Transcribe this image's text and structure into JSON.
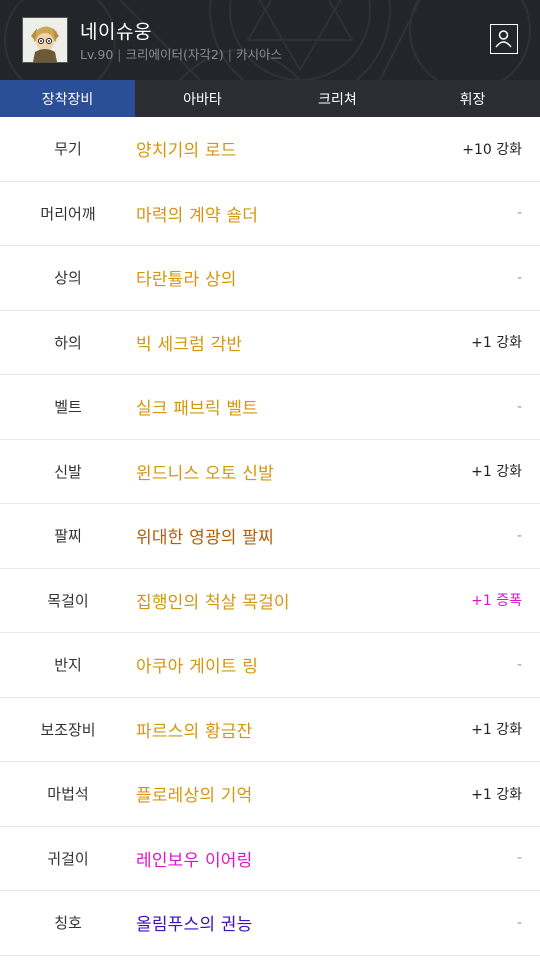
{
  "header": {
    "name": "네이슈웅",
    "level": "Lv.90",
    "job": "크리에이터(자각2)",
    "world": "카시아스",
    "avatar_icon": "character-avatar",
    "profile_icon": "profile-card-icon"
  },
  "tabs": [
    {
      "label": "장착장비",
      "active": true
    },
    {
      "label": "아바타",
      "active": false
    },
    {
      "label": "크리쳐",
      "active": false
    },
    {
      "label": "휘장",
      "active": false
    }
  ],
  "colors": {
    "header_bg": "#24252b",
    "tab_bg": "#2c2d33",
    "tab_active": "#2a4e98",
    "unique_gold": "#d4960f",
    "epic_orange": "#b35f05",
    "rare_pink": "#dd16c8",
    "legendary_purple": "#3f0fbf"
  },
  "equipment": [
    {
      "slot": "무기",
      "item": "양치기의 로드",
      "color": "#d4960f",
      "enhance": "+10 강화",
      "enhance_color": "#222222"
    },
    {
      "slot": "머리어깨",
      "item": "마력의 계약 숄더",
      "color": "#d4960f",
      "enhance": "-",
      "enhance_color": "#999999"
    },
    {
      "slot": "상의",
      "item": "타란튤라 상의",
      "color": "#d4960f",
      "enhance": "-",
      "enhance_color": "#999999"
    },
    {
      "slot": "하의",
      "item": "빅 세크럼 각반",
      "color": "#d4960f",
      "enhance": "+1 강화",
      "enhance_color": "#222222"
    },
    {
      "slot": "벨트",
      "item": "실크 패브릭 벨트",
      "color": "#d4960f",
      "enhance": "-",
      "enhance_color": "#999999"
    },
    {
      "slot": "신발",
      "item": "윈드니스 오토 신발",
      "color": "#d4960f",
      "enhance": "+1 강화",
      "enhance_color": "#222222"
    },
    {
      "slot": "팔찌",
      "item": "위대한 영광의 팔찌",
      "color": "#b35f05",
      "enhance": "-",
      "enhance_color": "#999999"
    },
    {
      "slot": "목걸이",
      "item": "집행인의 척살 목걸이",
      "color": "#d4960f",
      "enhance": "+1 증폭",
      "enhance_color": "#dd16c8"
    },
    {
      "slot": "반지",
      "item": "아쿠아 게이트 링",
      "color": "#d4960f",
      "enhance": "-",
      "enhance_color": "#999999"
    },
    {
      "slot": "보조장비",
      "item": "파르스의 황금잔",
      "color": "#d4960f",
      "enhance": "+1 강화",
      "enhance_color": "#222222"
    },
    {
      "slot": "마법석",
      "item": "플로레상의 기억",
      "color": "#d4960f",
      "enhance": "+1 강화",
      "enhance_color": "#222222"
    },
    {
      "slot": "귀걸이",
      "item": "레인보우 이어링",
      "color": "#dd16c8",
      "enhance": "-",
      "enhance_color": "#999999"
    },
    {
      "slot": "칭호",
      "item": "올림푸스의 권능",
      "color": "#3f0fbf",
      "enhance": "-",
      "enhance_color": "#999999"
    }
  ]
}
